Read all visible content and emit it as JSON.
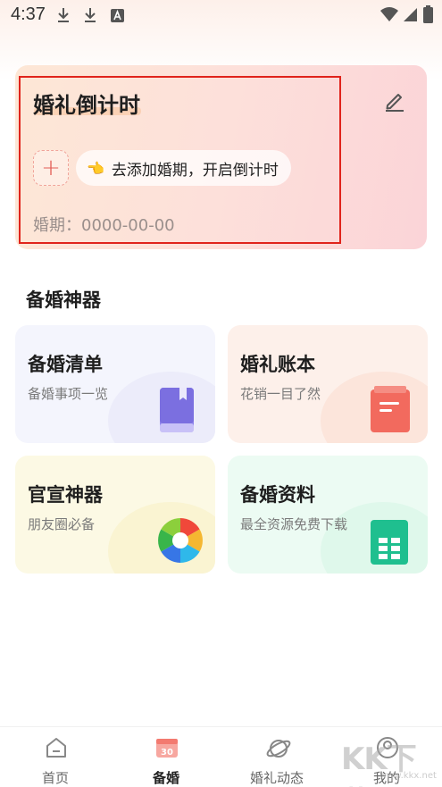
{
  "status_bar": {
    "time": "4:37"
  },
  "countdown": {
    "title": "婚礼倒计时",
    "add_symbol": "+",
    "hint_text": "去添加婚期，开启倒计时",
    "hint_hand": "👈",
    "date_label": "婚期：",
    "date_value": "0000-00-00"
  },
  "section": {
    "title": "备婚神器"
  },
  "tools": [
    {
      "title": "备婚清单",
      "subtitle": "备婚事项一览",
      "icon": "book-icon",
      "accent": "#7b6fe0"
    },
    {
      "title": "婚礼账本",
      "subtitle": "花销一目了然",
      "icon": "ledger-icon",
      "accent": "#f26a5e"
    },
    {
      "title": "官宣神器",
      "subtitle": "朋友圈必备",
      "icon": "aperture-icon",
      "accent": "#f5b731"
    },
    {
      "title": "备婚资料",
      "subtitle": "最全资源免费下载",
      "icon": "spreadsheet-icon",
      "accent": "#1fbf8f"
    }
  ],
  "nav": {
    "items": [
      {
        "label": "首页",
        "icon": "home-icon"
      },
      {
        "label": "备婚",
        "icon": "calendar-30-icon",
        "calendar_number": "30"
      },
      {
        "label": "婚礼动态",
        "icon": "planet-icon"
      },
      {
        "label": "我的",
        "icon": "profile-icon"
      }
    ],
    "active_index": 1
  },
  "watermark": {
    "text": "KK下载",
    "sub": "www.kkx.net"
  }
}
